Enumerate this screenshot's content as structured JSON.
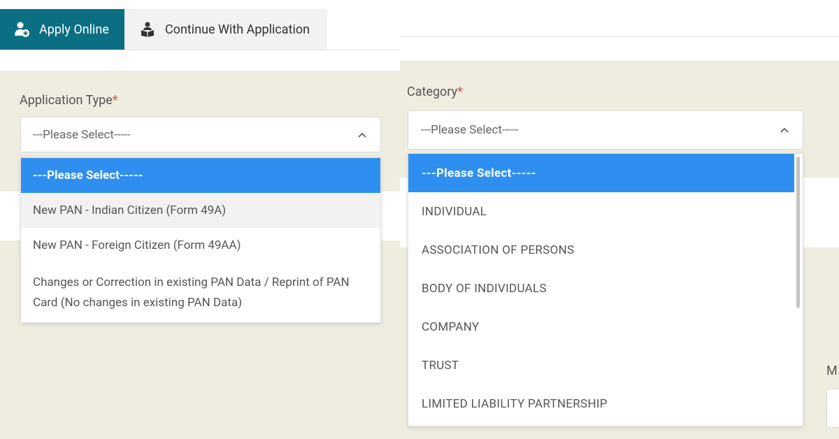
{
  "tabs": [
    {
      "label": "Apply Online",
      "icon": "user-plus-icon",
      "active": true
    },
    {
      "label": "Continue With Application",
      "icon": "person-reading-icon",
      "active": false
    }
  ],
  "application_type": {
    "label": "Application Type",
    "required_mark": "*",
    "selected": "---Please Select-----",
    "options": [
      "---Please Select-----",
      "New PAN - Indian Citizen (Form 49A)",
      "New PAN - Foreign Citizen (Form 49AA)",
      "Changes or Correction in existing PAN Data / Reprint of PAN Card (No changes in existing PAN Data)"
    ]
  },
  "category": {
    "label": "Category",
    "required_mark": "*",
    "selected": "---Please Select-----",
    "options": [
      "---Please Select-----",
      "INDIVIDUAL",
      "ASSOCIATION OF PERSONS",
      "BODY OF INDIVIDUALS",
      "COMPANY",
      "TRUST",
      "LIMITED LIABILITY PARTNERSHIP"
    ]
  },
  "partial_field": {
    "label": "M"
  },
  "colors": {
    "tab_active": "#0c6e82",
    "option_selected": "#2f8ff0",
    "panel_beige": "#efede0",
    "required": "#d9534f"
  }
}
